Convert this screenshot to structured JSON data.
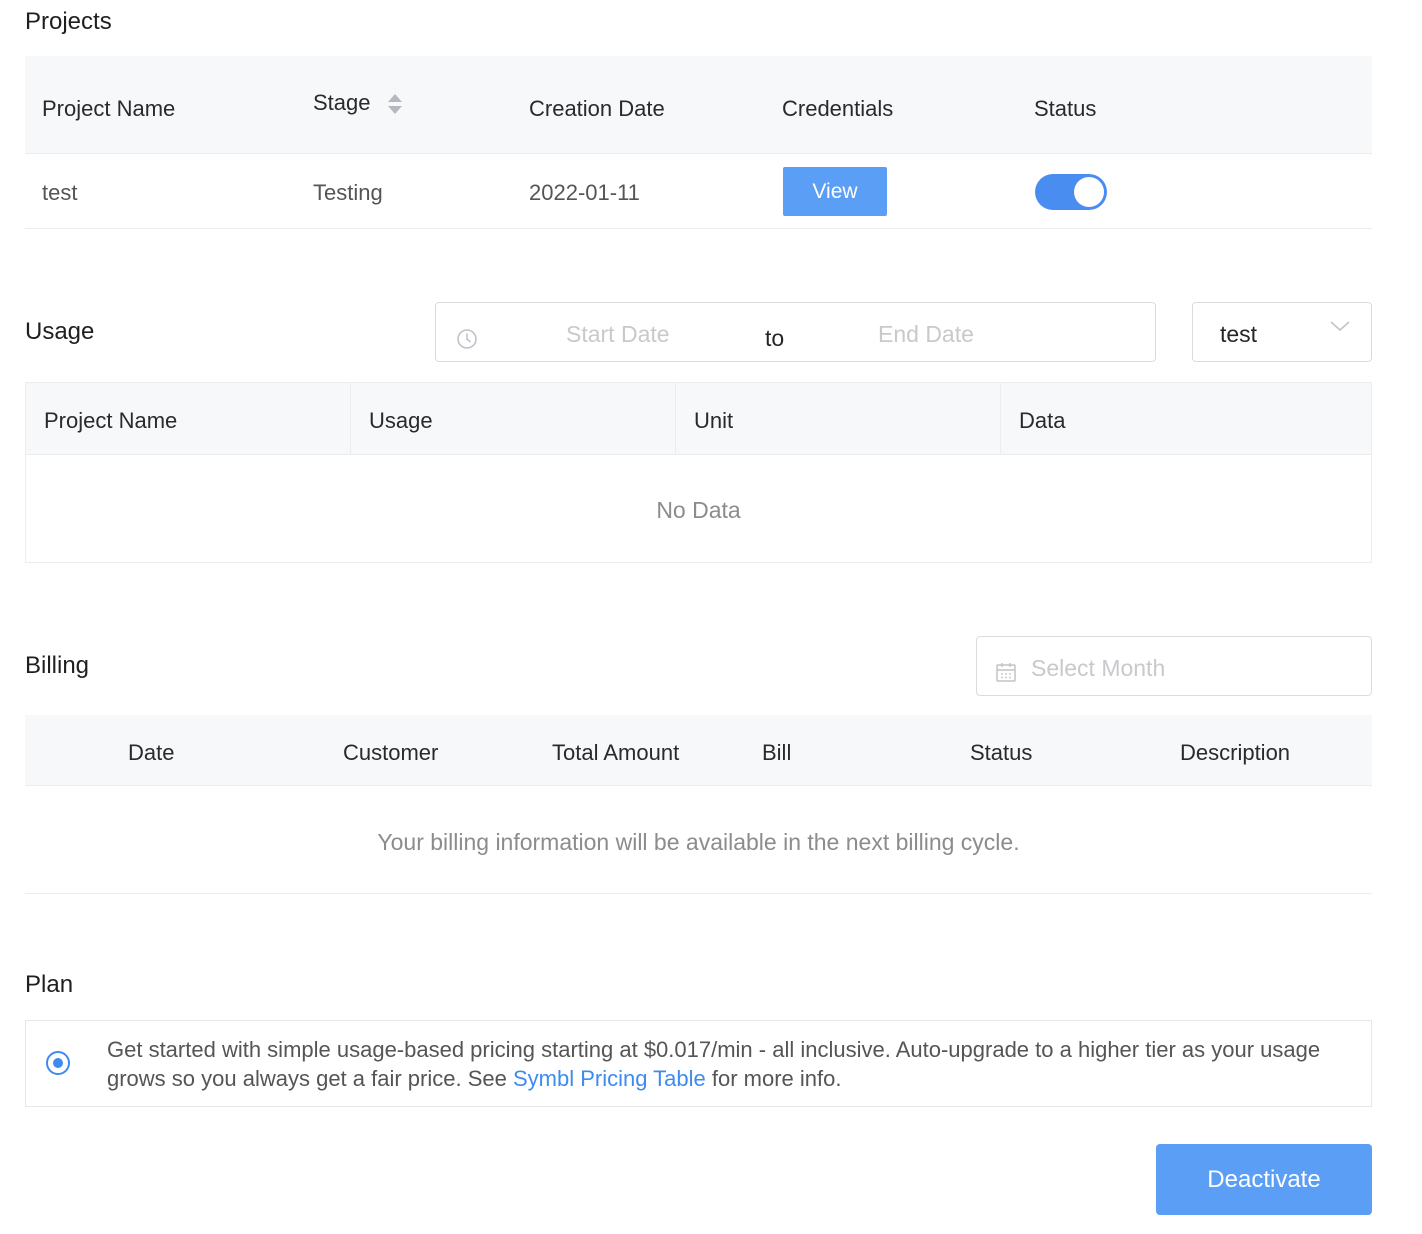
{
  "projects": {
    "title": "Projects",
    "columns": [
      "Project Name",
      "Stage",
      "Creation Date",
      "Credentials",
      "Status"
    ],
    "rows": [
      {
        "name": "test",
        "stage": "Testing",
        "created": "2022-01-11",
        "credentials_label": "View",
        "status_on": true
      }
    ]
  },
  "usage": {
    "title": "Usage",
    "start_placeholder": "Start Date",
    "separator": "to",
    "end_placeholder": "End Date",
    "project_select": "test",
    "columns": [
      "Project Name",
      "Usage",
      "Unit",
      "Data"
    ],
    "empty_text": "No Data"
  },
  "billing": {
    "title": "Billing",
    "month_placeholder": "Select Month",
    "columns": [
      "Date",
      "Customer",
      "Total Amount",
      "Bill",
      "Status",
      "Description"
    ],
    "empty_text": "Your billing information will be available in the next billing cycle."
  },
  "plan": {
    "title": "Plan",
    "text_before": "Get started with simple usage-based pricing starting at $0.017/min - all inclusive. Auto-upgrade to a higher tier as your usage grows so you always get a fair price. See ",
    "link_text": "Symbl Pricing Table",
    "text_after": " for more info.",
    "selected": true
  },
  "actions": {
    "deactivate_label": "Deactivate"
  },
  "colors": {
    "primary": "#5b9ef5",
    "toggle_on": "#4a8df0",
    "link": "#3e8bf0",
    "header_bg": "#f7f8fa"
  }
}
